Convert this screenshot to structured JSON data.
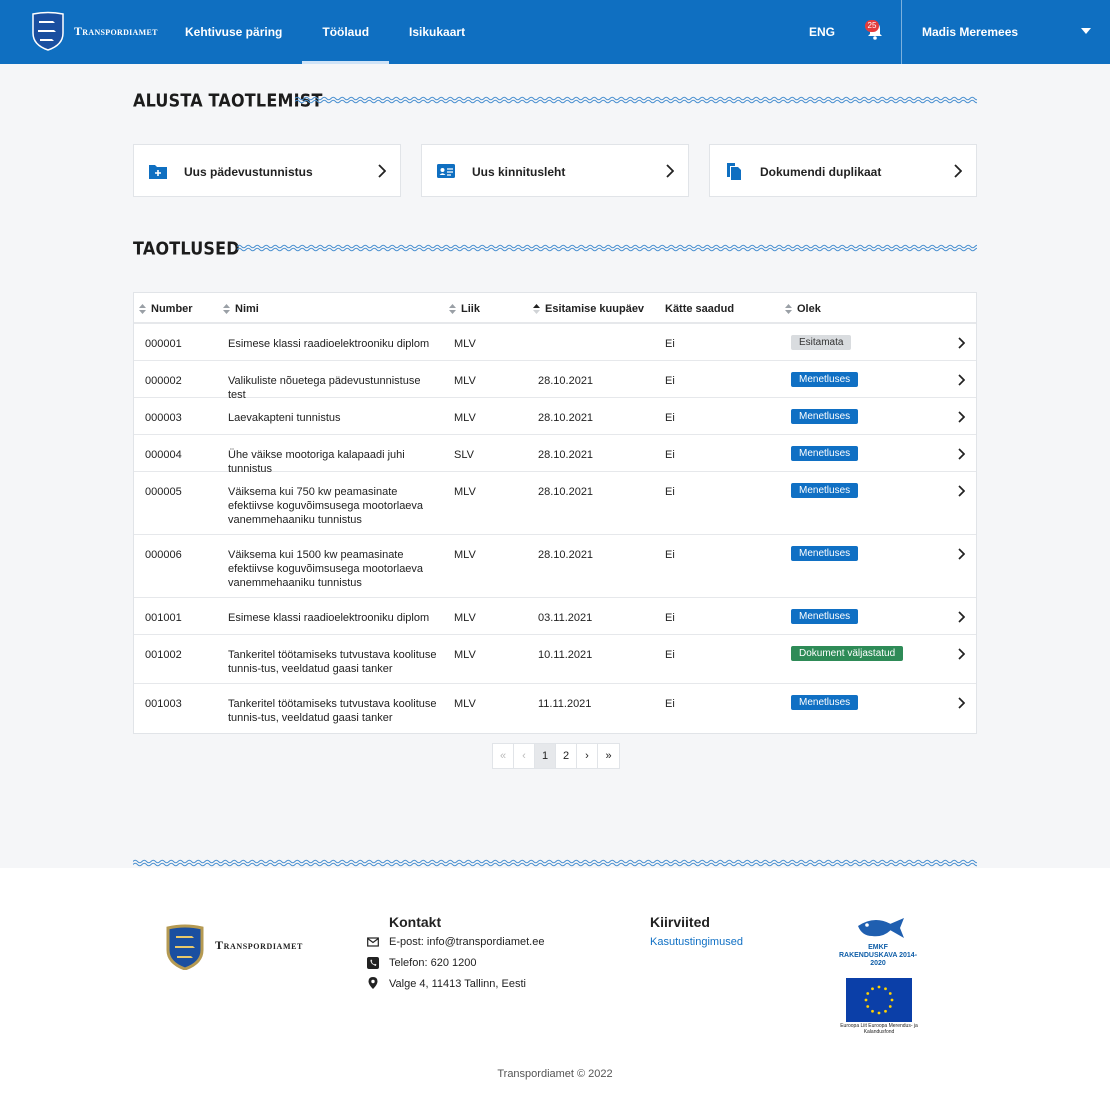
{
  "header": {
    "logo_text": "Transpordiamet",
    "nav": [
      {
        "label": "Kehtivuse päring",
        "active": false
      },
      {
        "label": "Töölaud",
        "active": true
      },
      {
        "label": "Isikukaart",
        "active": false
      }
    ],
    "language": "ENG",
    "notification_count": "25",
    "user_name": "Madis Meremees"
  },
  "start": {
    "title": "ALUSTA TAOTLEMIST",
    "cards": [
      {
        "label": "Uus pädevustunnistus",
        "icon": "folder-plus-icon"
      },
      {
        "label": "Uus kinnitusleht",
        "icon": "id-card-icon"
      },
      {
        "label": "Dokumendi duplikaat",
        "icon": "copy-document-icon"
      }
    ]
  },
  "applications": {
    "title": "TAOTLUSED",
    "columns": [
      "Number",
      "Nimi",
      "Liik",
      "Esitamise kuupäev",
      "Kätte saadud",
      "Olek"
    ],
    "rows": [
      {
        "number": "000001",
        "name": "Esimese klassi raadioelektrooniku diplom",
        "type": "MLV",
        "date": "",
        "received": "Ei",
        "status": "Esitamata",
        "status_kind": "grey"
      },
      {
        "number": "000002",
        "name": "Valikuliste nõuetega pädevustunnistuse test",
        "type": "MLV",
        "date": "28.10.2021",
        "received": "Ei",
        "status": "Menetluses",
        "status_kind": "blue"
      },
      {
        "number": "000003",
        "name": "Laevakapteni tunnistus",
        "type": "MLV",
        "date": "28.10.2021",
        "received": "Ei",
        "status": "Menetluses",
        "status_kind": "blue"
      },
      {
        "number": "000004",
        "name": "Ühe väikse mootoriga kalapaadi juhi tunnistus",
        "type": "SLV",
        "date": "28.10.2021",
        "received": "Ei",
        "status": "Menetluses",
        "status_kind": "blue"
      },
      {
        "number": "000005",
        "name": "Väiksema kui 750 kw peamasinate efektiivse koguvõimsusega mootorlaeva vanemmehaaniku tunnistus",
        "type": "MLV",
        "date": "28.10.2021",
        "received": "Ei",
        "status": "Menetluses",
        "status_kind": "blue"
      },
      {
        "number": "000006",
        "name": "Väiksema kui 1500 kw peamasinate efektiivse koguvõimsusega mootorlaeva vanemmehaaniku tunnistus",
        "type": "MLV",
        "date": "28.10.2021",
        "received": "Ei",
        "status": "Menetluses",
        "status_kind": "blue"
      },
      {
        "number": "001001",
        "name": "Esimese klassi raadioelektrooniku diplom",
        "type": "MLV",
        "date": "03.11.2021",
        "received": "Ei",
        "status": "Menetluses",
        "status_kind": "blue"
      },
      {
        "number": "001002",
        "name": "Tankeritel töötamiseks tutvustava koolituse tunnis-tus, veeldatud gaasi tanker",
        "type": "MLV",
        "date": "10.11.2021",
        "received": "Ei",
        "status": "Dokument väljastatud",
        "status_kind": "green"
      },
      {
        "number": "001003",
        "name": "Tankeritel töötamiseks tutvustava koolituse tunnis-tus, veeldatud gaasi tanker",
        "type": "MLV",
        "date": "11.11.2021",
        "received": "Ei",
        "status": "Menetluses",
        "status_kind": "blue"
      }
    ]
  },
  "pagination": {
    "items": [
      "«",
      "‹",
      "1",
      "2",
      "›",
      "»"
    ],
    "current": "1"
  },
  "footer": {
    "logo_text": "Transpordiamet",
    "contact_title": "Kontakt",
    "email": "E-post: info@transpordiamet.ee",
    "phone": "Telefon: 620 1200",
    "address": "Valge 4, 11413 Tallinn, Eesti",
    "links_title": "Kiirviited",
    "links": [
      "Kasutustingimused"
    ],
    "emkf_text": "EMKF RAKENDUSKAVA 2014-2020",
    "eu_text": "Euroopa Liit Euroopa Merendus- ja Kalandusfond",
    "copyright": "Transpordiamet © 2022"
  },
  "colors": {
    "brand_blue": "#0f6fc1",
    "status_blue": "#1070c4",
    "status_green": "#2e8b57",
    "status_grey": "#d9dcdf"
  }
}
